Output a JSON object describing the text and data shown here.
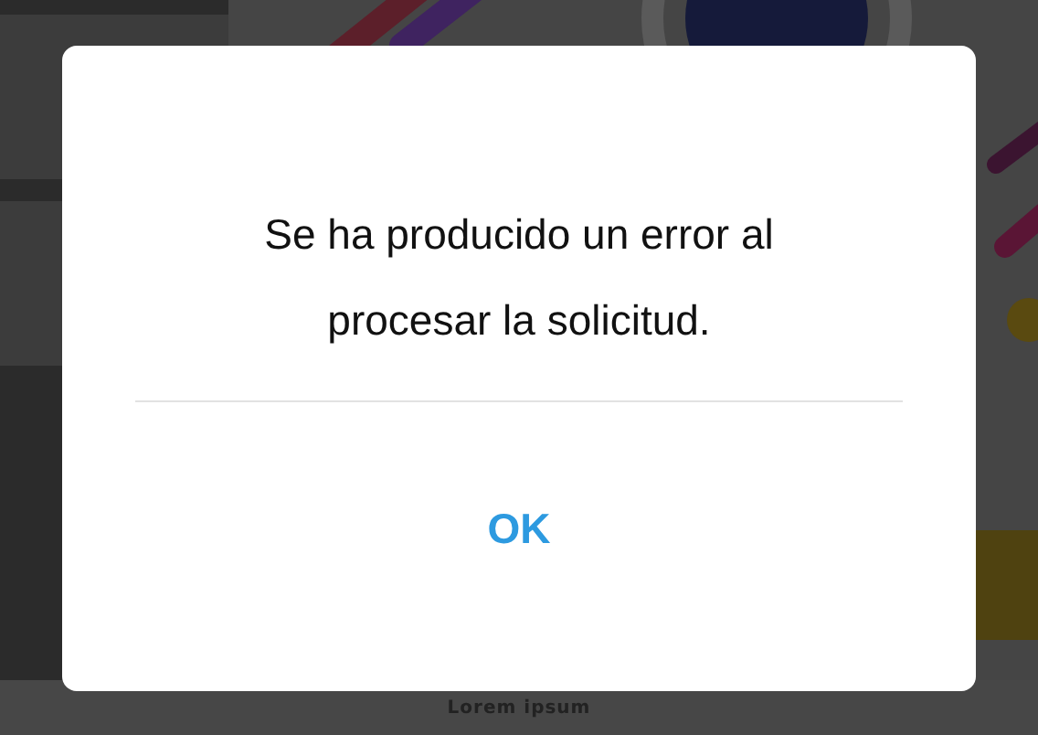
{
  "background": {
    "caption": "Lorem ipsum"
  },
  "dialog": {
    "message": "Se ha producido un error al procesar la solicitud.",
    "buttons": [
      {
        "label": "OK",
        "kind": "primary"
      }
    ]
  }
}
